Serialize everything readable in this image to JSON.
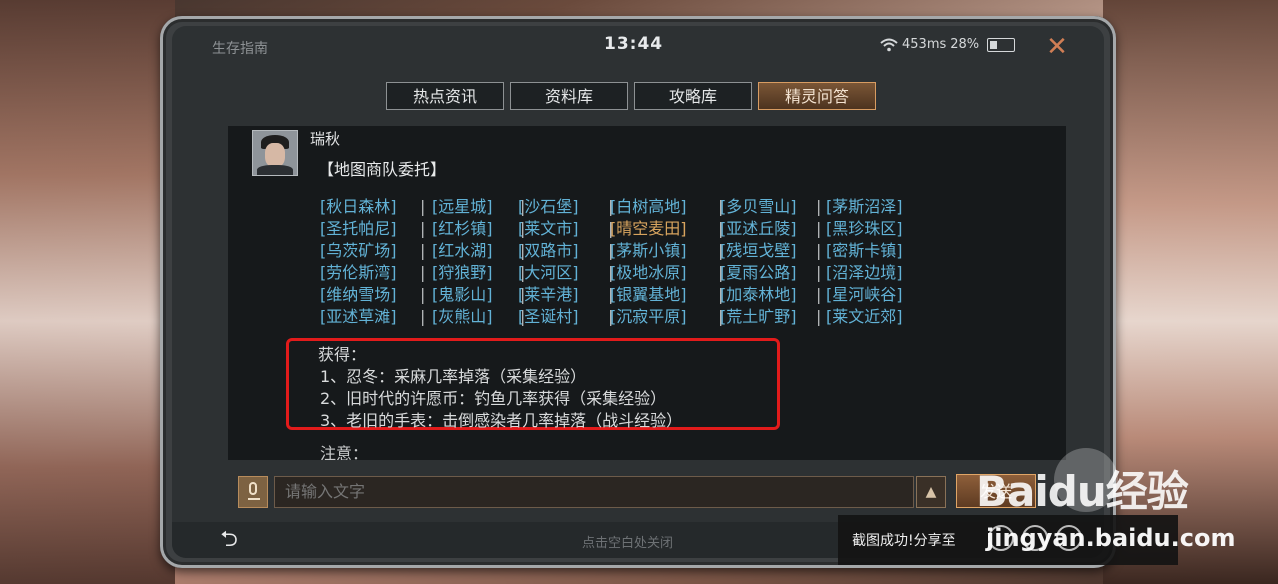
{
  "app_title": "生存指南",
  "clock": "13:44",
  "status": {
    "ping": "453ms",
    "battery": "28%"
  },
  "tabs": [
    "热点资讯",
    "资料库",
    "攻略库",
    "精灵问答"
  ],
  "active_tab": "精灵问答",
  "message": {
    "sender": "瑞秋",
    "title": "【地图商队委托】",
    "locations": [
      [
        "[秋日森林]",
        "[远星城]",
        "[沙石堡]",
        "[白树高地]",
        "[多贝雪山]",
        "[茅斯沼泽]"
      ],
      [
        "[圣托帕尼]",
        "[红杉镇]",
        "[莱文市]",
        "[晴空麦田]",
        "[亚述丘陵]",
        "[黑珍珠区]"
      ],
      [
        "[乌茨矿场]",
        "[红水湖]",
        "[双路市]",
        "[茅斯小镇]",
        "[残垣戈壁]",
        "[密斯卡镇]"
      ],
      [
        "[劳伦斯湾]",
        "[狩狼野]",
        "[大河区]",
        "[极地冰原]",
        "[夏雨公路]",
        "[沼泽边境]"
      ],
      [
        "[维纳雪场]",
        "[鬼影山]",
        "[莱辛港]",
        "[银翼基地]",
        "[加泰林地]",
        "[星河峡谷]"
      ],
      [
        "[亚述草滩]",
        "[灰熊山]",
        "[圣诞村]",
        "[沉寂平原]",
        "[荒土旷野]",
        "[莱文近郊]"
      ]
    ],
    "separator": "|",
    "rewards_heading": "获得：",
    "rewards": [
      "1、忍冬：采麻几率掉落（采集经验）",
      "2、旧时代的许愿币：钓鱼几率获得（采集经验）",
      "3、老旧的手表：击倒感染者几率掉落（战斗经验）"
    ],
    "note_heading": "注意："
  },
  "input": {
    "placeholder": "请输入文字"
  },
  "send_label": "发送",
  "bottom_hint": "点击空白处关闭",
  "toast": {
    "text": "截图成功!分享至"
  },
  "watermark": {
    "brand": "Baidu经验",
    "url": "jingyan.baidu.com"
  },
  "colors": {
    "accent": "#d89c62",
    "link": "#62b2d6",
    "highlight_link": "#d8a45e",
    "annotation_box": "#e21b1b"
  }
}
